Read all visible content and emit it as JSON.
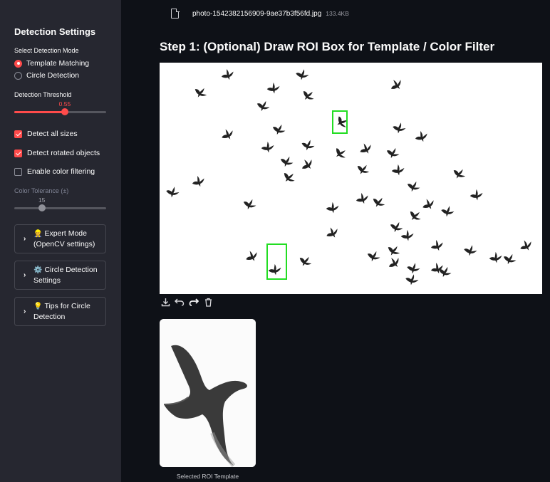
{
  "sidebar": {
    "title": "Detection Settings",
    "mode_label": "Select Detection Mode",
    "modes": [
      {
        "label": "Template Matching",
        "selected": true
      },
      {
        "label": "Circle Detection",
        "selected": false
      }
    ],
    "threshold_label": "Detection Threshold",
    "threshold_value": "0.55",
    "threshold_fraction": 0.55,
    "checkboxes": [
      {
        "label": "Detect all sizes",
        "checked": true
      },
      {
        "label": "Detect rotated objects",
        "checked": true
      },
      {
        "label": "Enable color filtering",
        "checked": false
      }
    ],
    "tolerance_label": "Color Tolerance (±)",
    "tolerance_value": "15",
    "tolerance_fraction": 0.3,
    "expanders": [
      {
        "icon": "👷",
        "line1": "Expert Mode",
        "line2": "(OpenCV settings)"
      },
      {
        "icon": "⚙️",
        "line1": "Circle Detection",
        "line2": "Settings"
      },
      {
        "icon": "💡",
        "line1": "Tips for Circle",
        "line2": "Detection"
      }
    ]
  },
  "file": {
    "name": "photo-1542382156909-9ae37b3f56fd.jpg",
    "size": "133.4KB",
    "icon": "file-icon"
  },
  "step_title": "Step 1: (Optional) Draw ROI Box for Template / Color Filter",
  "toolbar": {
    "icons": [
      "download-icon",
      "undo-icon",
      "redo-icon",
      "trash-icon"
    ]
  },
  "roi_caption": "Selected ROI Template",
  "colors": {
    "accent": "#ff4b4b",
    "sidebar_bg": "#262730",
    "main_bg": "#0e1117",
    "roi_box": "#22dd22"
  }
}
